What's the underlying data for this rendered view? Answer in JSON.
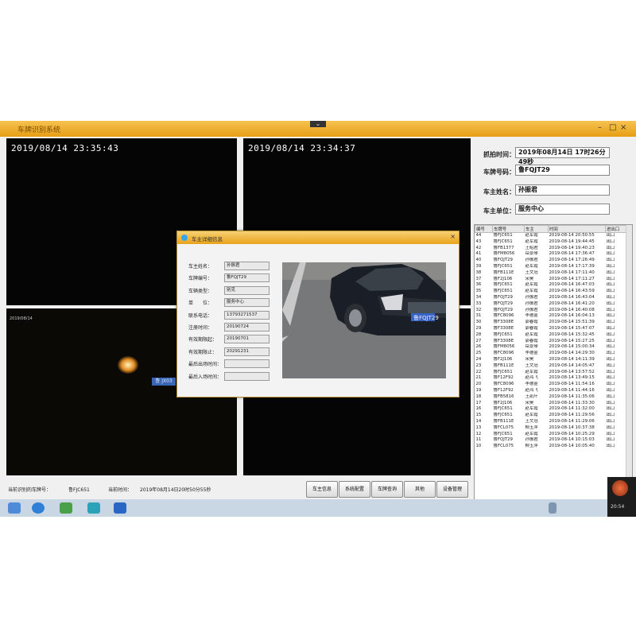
{
  "window": {
    "title": "车牌识别系统"
  },
  "cameras": [
    {
      "timestamp": "2019/08/14  23:35:43"
    },
    {
      "timestamp": "2019/08/14  23:34:37"
    },
    {
      "timestamp": "2019/08/14",
      "plate_overlay": "鲁 JX03"
    },
    {
      "timestamp": ""
    }
  ],
  "right_panel": {
    "capture_time_label": "抓拍时间：",
    "capture_time_value": "2019年08月14日 17时26分49秒",
    "plate_label": "车牌号码：",
    "plate_value": "鲁FQJT29",
    "owner_label": "车主姓名：",
    "owner_value": "孙振君",
    "unit_label": "车主单位：",
    "unit_value": "服务中心"
  },
  "log": {
    "headers": [
      "编号",
      "车牌号",
      "车主",
      "时间",
      "进出口"
    ],
    "rows": [
      [
        "44",
        "鲁FJC651",
        "赵军霞",
        "2019-08-14 20:50:55",
        "出口"
      ],
      [
        "43",
        "鲁FJC651",
        "赵军霞",
        "2019-08-14 19:44:45",
        "出口"
      ],
      [
        "42",
        "鲁FB1377",
        "王昭君",
        "2019-08-14 19:40:23",
        "出口"
      ],
      [
        "41",
        "鲁FM8056",
        "岳景琴",
        "2019-08-14 17:36:47",
        "出口"
      ],
      [
        "40",
        "鲁FQJT29",
        "孙振君",
        "2019-08-14 17:26:49",
        "出口"
      ],
      [
        "39",
        "鲁FJC651",
        "赵军霞",
        "2019-08-14 17:17:39",
        "出口"
      ],
      [
        "38",
        "鲁FB111E",
        "王文冠",
        "2019-08-14 17:11:40",
        "出口"
      ],
      [
        "37",
        "鲁F2J106",
        "宋昊",
        "2019-08-14 17:11:27",
        "出口"
      ],
      [
        "36",
        "鲁FJC651",
        "赵军霞",
        "2019-08-14 16:47:03",
        "出口"
      ],
      [
        "35",
        "鲁FJC651",
        "赵军霞",
        "2019-08-14 16:43:59",
        "出口"
      ],
      [
        "34",
        "鲁FQJT29",
        "孙振君",
        "2019-08-14 16:43:04",
        "出口"
      ],
      [
        "33",
        "鲁FQJT29",
        "孙振君",
        "2019-08-14 16:41:20",
        "出口"
      ],
      [
        "32",
        "鲁FQJT29",
        "孙振君",
        "2019-08-14 16:40:08",
        "出口"
      ],
      [
        "31",
        "鲁FC8096",
        "李德金",
        "2019-08-14 16:04:13",
        "出口"
      ],
      [
        "30",
        "鲁F3308E",
        "郭春霞",
        "2019-08-14 15:51:39",
        "出口"
      ],
      [
        "29",
        "鲁F3308E",
        "郭春霞",
        "2019-08-14 15:47:07",
        "出口"
      ],
      [
        "28",
        "鲁FJC651",
        "赵军霞",
        "2019-08-14 15:32:45",
        "出口"
      ],
      [
        "27",
        "鲁F3308E",
        "郭春霞",
        "2019-08-14 15:27:25",
        "出口"
      ],
      [
        "26",
        "鲁FM8056",
        "岳景琴",
        "2019-08-14 15:00:34",
        "出口"
      ],
      [
        "25",
        "鲁FC8096",
        "李德金",
        "2019-08-14 14:29:30",
        "出口"
      ],
      [
        "24",
        "鲁F2J106",
        "宋昊",
        "2019-08-14 14:11:39",
        "出口"
      ],
      [
        "23",
        "鲁FB111E",
        "王文冠",
        "2019-08-14 14:05:47",
        "出口"
      ],
      [
        "22",
        "鲁FJC651",
        "赵军霞",
        "2019-08-14 13:57:52",
        "出口"
      ],
      [
        "21",
        "鲁F12F92",
        "赵鸿飞",
        "2019-08-14 13:49:15",
        "出口"
      ],
      [
        "20",
        "鲁FC8096",
        "李德金",
        "2019-08-14 11:54:16",
        "出口"
      ],
      [
        "19",
        "鲁F12F92",
        "赵鸿飞",
        "2019-08-14 11:44:16",
        "出口"
      ],
      [
        "18",
        "鲁FB5816",
        "王贰阡",
        "2019-08-14 11:35:06",
        "出口"
      ],
      [
        "17",
        "鲁F2J106",
        "宋昊",
        "2019-08-14 11:33:30",
        "出口"
      ],
      [
        "16",
        "鲁FJC651",
        "赵军霞",
        "2019-08-14 11:32:00",
        "出口"
      ],
      [
        "15",
        "鲁FJC651",
        "赵军霞",
        "2019-08-14 11:29:56",
        "出口"
      ],
      [
        "14",
        "鲁FB111E",
        "王文冠",
        "2019-08-14 11:29:06",
        "出口"
      ],
      [
        "13",
        "鲁FCL075",
        "柳玉萍",
        "2019-08-14 10:37:38",
        "出口"
      ],
      [
        "12",
        "鲁FJC651",
        "赵军霞",
        "2019-08-14 10:25:29",
        "出口"
      ],
      [
        "11",
        "鲁FQJT29",
        "孙振君",
        "2019-08-14 10:15:03",
        "出口"
      ],
      [
        "10",
        "鲁FCL075",
        "柳玉萍",
        "2019-08-14 10:05:40",
        "出口"
      ]
    ]
  },
  "bottom": {
    "current_plate_label": "当前识别的车牌号：",
    "current_plate_value": "鲁FJC651",
    "current_time_label": "当前时间：",
    "current_time_value": "2019年08月14日20时50分55秒",
    "buttons": [
      "车主信息",
      "系统配置",
      "车牌查询",
      "其他",
      "设备管理"
    ]
  },
  "dialog": {
    "title": "车主详细信息",
    "fields": [
      {
        "label": "车主姓名：",
        "value": "孙振君"
      },
      {
        "label": "车牌编号：",
        "value": "鲁FQJT29"
      },
      {
        "label": "车辆类型：",
        "value": "别克"
      },
      {
        "label": "单　　位：",
        "value": "服务中心"
      },
      {
        "label": "联系电话：",
        "value": "13793271537"
      },
      {
        "label": "注册时间：",
        "value": "20190724"
      },
      {
        "label": "有效期限起：",
        "value": "20190701"
      },
      {
        "label": "有效期限止：",
        "value": "20291231"
      },
      {
        "label": "最后出场时间：",
        "value": ""
      },
      {
        "label": "最后入场时间：",
        "value": ""
      }
    ],
    "photo_plate": "鲁FQJT29"
  },
  "tray": {
    "time": "20:54"
  }
}
